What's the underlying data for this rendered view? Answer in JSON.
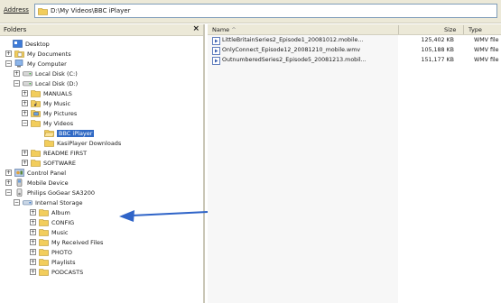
{
  "address_bar": {
    "label": "Address",
    "path": "D:\\My Videos\\BBC iPlayer"
  },
  "folders_pane": {
    "title": "Folders",
    "close_glyph": "×",
    "tree": [
      {
        "label": "Desktop",
        "expander": "",
        "icon": "desktop-icon"
      },
      {
        "label": "My Documents",
        "expander": "+",
        "icon": "documents-folder-icon"
      },
      {
        "label": "My Computer",
        "expander": "−",
        "icon": "computer-icon"
      },
      {
        "label": "Local Disk (C:)",
        "expander": "+",
        "icon": "disk-icon"
      },
      {
        "label": "Local Disk (D:)",
        "expander": "−",
        "icon": "disk-icon"
      },
      {
        "label": "MANUALS",
        "expander": "+",
        "icon": "folder-icon"
      },
      {
        "label": "My Music",
        "expander": "+",
        "icon": "music-folder-icon"
      },
      {
        "label": "My Pictures",
        "expander": "+",
        "icon": "pictures-folder-icon"
      },
      {
        "label": "My Videos",
        "expander": "−",
        "icon": "folder-icon"
      },
      {
        "label": "BBC iPlayer",
        "expander": "",
        "icon": "open-folder-icon"
      },
      {
        "label": "KasiPlayer Downloads",
        "expander": "",
        "icon": "folder-icon"
      },
      {
        "label": "README FIRST",
        "expander": "+",
        "icon": "folder-icon"
      },
      {
        "label": "SOFTWARE",
        "expander": "+",
        "icon": "folder-icon"
      },
      {
        "label": "Control Panel",
        "expander": "+",
        "icon": "control-panel-icon"
      },
      {
        "label": "Mobile Device",
        "expander": "+",
        "icon": "mobile-device-icon"
      },
      {
        "label": "Philips GoGear SA3200",
        "expander": "−",
        "icon": "player-icon"
      },
      {
        "label": "Internal Storage",
        "expander": "−",
        "icon": "storage-icon"
      },
      {
        "label": "Album",
        "expander": "+",
        "icon": "folder-icon"
      },
      {
        "label": "CONFIG",
        "expander": "+",
        "icon": "folder-icon"
      },
      {
        "label": "Music",
        "expander": "+",
        "icon": "folder-icon"
      },
      {
        "label": "My Received Files",
        "expander": "+",
        "icon": "folder-icon"
      },
      {
        "label": "PHOTO",
        "expander": "+",
        "icon": "folder-icon"
      },
      {
        "label": "Playlists",
        "expander": "+",
        "icon": "folder-icon"
      },
      {
        "label": "PODCASTS",
        "expander": "+",
        "icon": "folder-icon"
      }
    ],
    "selected": "BBC iPlayer"
  },
  "files_pane": {
    "columns": {
      "name": "Name",
      "size": "Size",
      "type": "Type"
    },
    "files": [
      {
        "name": "LittleBritainSeries2_Episode1_20081012.mobile...",
        "size": "125,402 KB",
        "type": "WMV file"
      },
      {
        "name": "OnlyConnect_Episode12_20081210_mobile.wmv",
        "size": "105,188 KB",
        "type": "WMV file"
      },
      {
        "name": "OutnumberedSeries2_Episode5_20081213.mobil...",
        "size": "151,177 KB",
        "type": "WMV file"
      }
    ]
  },
  "colors": {
    "chrome": "#ece9d8",
    "selection": "#316ac5",
    "folder": "#f2cd5c",
    "arrow": "#2f64c8"
  }
}
